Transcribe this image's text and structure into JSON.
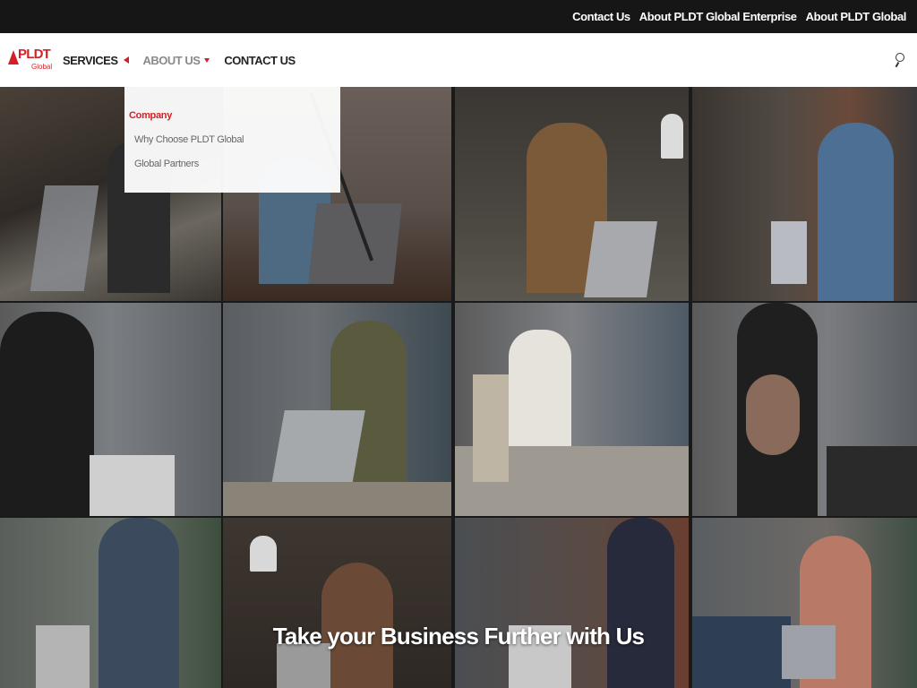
{
  "top_links": [
    "Contact Us",
    "About PLDT Global Enterprise",
    "About PLDT Global"
  ],
  "logo": {
    "text": "PLDT",
    "sub": "Global"
  },
  "nav": {
    "services": "SERVICES",
    "about": "ABOUT US",
    "contact": "CONTACT US"
  },
  "dropdown": {
    "heading": "Company",
    "items": [
      "Why Choose PLDT Global",
      "Global Partners"
    ]
  },
  "hero": {
    "title": "Take your Business Further with Us"
  },
  "colors": {
    "brand_red": "#d31f26",
    "topbar_bg": "#161616",
    "nav_bg": "#ffffff"
  },
  "icons": {
    "search": "search-icon",
    "services_caret": "caret-left-icon",
    "about_caret": "caret-down-icon"
  }
}
